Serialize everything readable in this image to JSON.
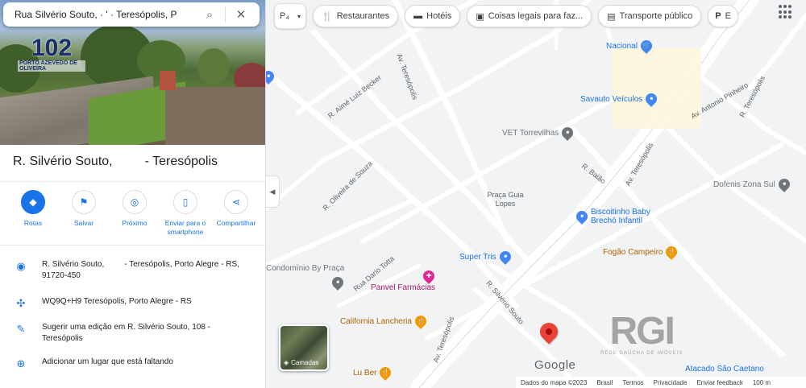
{
  "search": {
    "value": "Rua Silvério Souto, · ' · Teresópolis, P",
    "close_label": "✕"
  },
  "photo": {
    "logo_number": "102",
    "logo_text": "PORTO AZEVEDO DE OLIVEIRA"
  },
  "place": {
    "title": "R. Silvério Souto,         - Teresópolis"
  },
  "actions": [
    {
      "label": "Rotas",
      "icon": "directions-icon"
    },
    {
      "label": "Salvar",
      "icon": "bookmark-icon"
    },
    {
      "label": "Próximo",
      "icon": "nearby-icon"
    },
    {
      "label": "Enviar para o smartphone",
      "icon": "send-to-phone-icon"
    },
    {
      "label": "Compartilhar",
      "icon": "share-icon"
    }
  ],
  "info": {
    "address": "R. Silvério Souto,         - Teresópolis, Porto Alegre - RS, 91720-450",
    "plus_code": "WQ9Q+H9 Teresópolis, Porto Alegre - RS",
    "suggest_edit": "Sugerir uma edição em R. Silvério Souto, 108 - Teresópolis",
    "add_place": "Adicionar um lugar que está faltando"
  },
  "chips": {
    "layer_label": "P₄",
    "restaurants": "Restaurantes",
    "hotels": "Hotéis",
    "things_to_do": "Coisas legais para faz...",
    "transit": "Transporte público",
    "more": "E"
  },
  "map": {
    "streets": {
      "s1": "R. Aimé Luiz Becker",
      "s2": "Av. Teresópolis",
      "s3": "Av. Antonio Pinheiro",
      "s4": "R. Oliveira de Souza",
      "s5": "R. Baião",
      "s6": "Av. Teresópolis",
      "s7": "Rua Dario Totta",
      "s8": "R. Silvério Souto",
      "s9": "Av. Teresópolis",
      "s10": "R. Teresópolis"
    },
    "pois": {
      "nacional": "Nacional",
      "savauto": "Savauto Veículos",
      "vet": "VET Torrevilhas",
      "dofenis": "Dofenis Zona Sul",
      "biscoitinho": "Biscoitinho Baby Brechó Infantil",
      "fogao": "Fogão Campeiro",
      "super_tris": "Super Tris",
      "condominio": "Condomínio By Praça",
      "panvel": "Panvel Farmácias",
      "california": "California Lancheria",
      "lu_ber": "Lu Ber",
      "atacado": "Atacado São Caetano"
    },
    "praca": "Praça Guia Lopes",
    "layers_label": "Camadas",
    "google": "Google",
    "watermark": "RGI",
    "watermark_sub": "REDE GAÚCHA DE IMÓVEIS",
    "footer": {
      "data": "Dados do mapa ©2023",
      "brasil": "Brasil",
      "termos": "Termos",
      "privacidade": "Privacidade",
      "feedback": "Enviar feedback",
      "scale": "100 m"
    }
  }
}
